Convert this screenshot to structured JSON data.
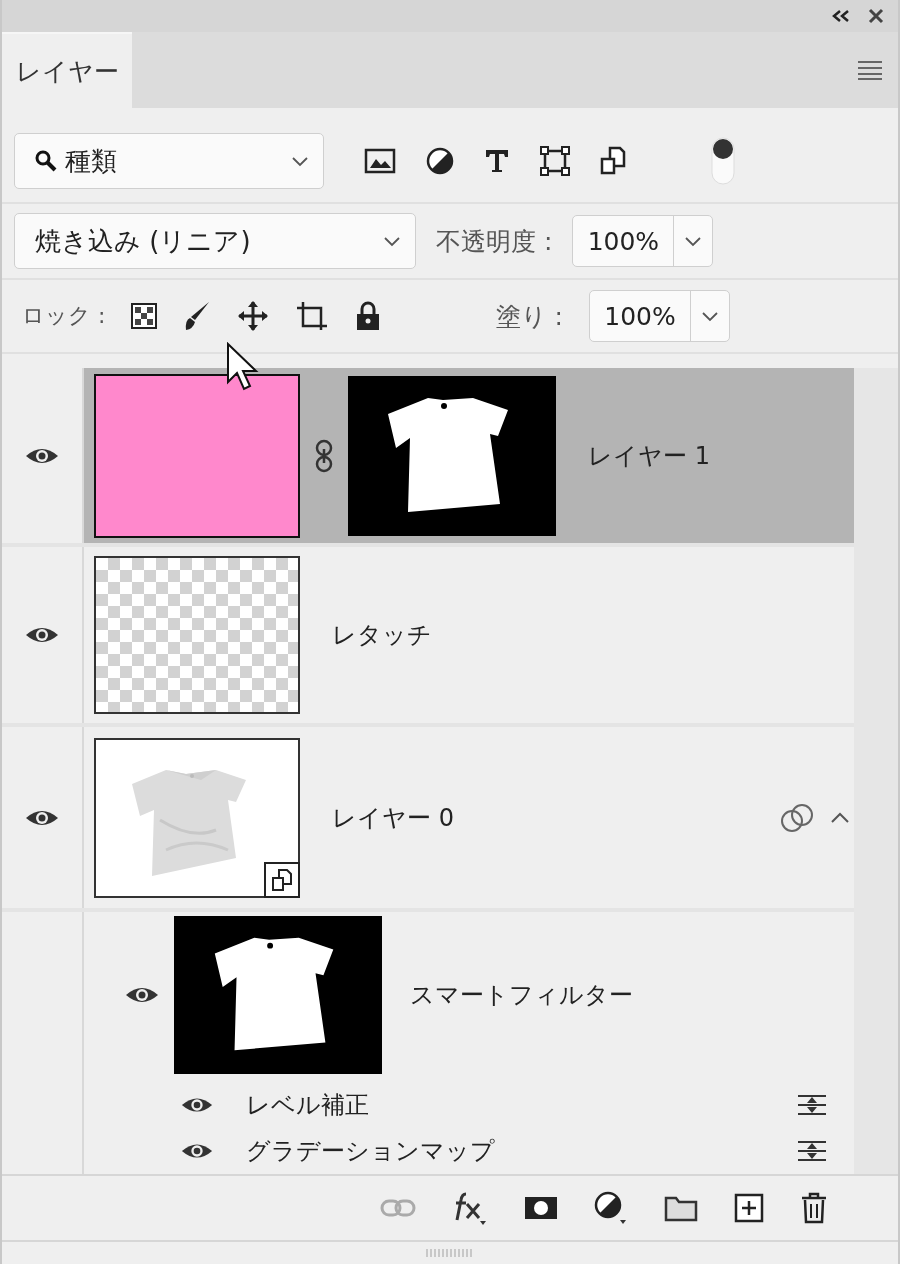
{
  "panel_tab": {
    "label": "レイヤー",
    "selected": true
  },
  "filter": {
    "kind_label": "種類",
    "toggle_on": true
  },
  "blend_mode": "焼き込み (リニア)",
  "opacity": {
    "label": "不透明度 :",
    "value": "100%"
  },
  "lock": {
    "label": "ロック :"
  },
  "fill": {
    "label": "塗り :",
    "value": "100%"
  },
  "layers": [
    {
      "name": "レイヤー 1",
      "visible": true,
      "selected": true,
      "kind": "fill_mask"
    },
    {
      "name": "レタッチ",
      "visible": true,
      "selected": false,
      "kind": "transparent"
    },
    {
      "name": "レイヤー 0",
      "visible": true,
      "selected": false,
      "kind": "smart_object",
      "expanded": true
    }
  ],
  "smart_filters": {
    "label": "スマートフィルター",
    "visible": true,
    "filters": [
      {
        "name": "レベル補正",
        "visible": true
      },
      {
        "name": "グラデーションマップ",
        "visible": true
      }
    ]
  }
}
